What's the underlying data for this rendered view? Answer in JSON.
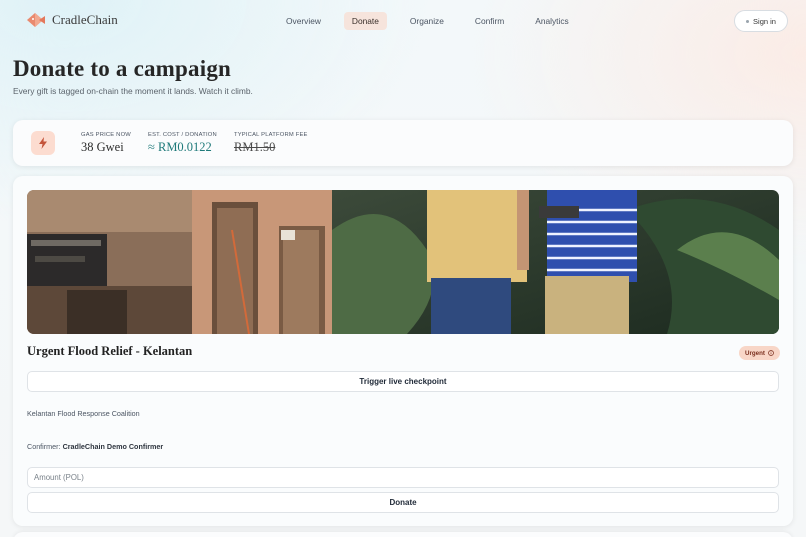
{
  "brand": {
    "name": "CradleChain"
  },
  "nav": {
    "tabs": [
      {
        "label": "Overview",
        "active": false
      },
      {
        "label": "Donate",
        "active": true
      },
      {
        "label": "Organize",
        "active": false
      },
      {
        "label": "Confirm",
        "active": false
      },
      {
        "label": "Analytics",
        "active": false
      }
    ],
    "signin_label": "Sign in"
  },
  "header": {
    "title": "Donate to a campaign",
    "subtitle": "Every gift is tagged on-chain the moment it lands. Watch it climb."
  },
  "gas": {
    "icon": "lightning-icon",
    "stats": [
      {
        "label": "GAS PRICE NOW",
        "value": "38 Gwei"
      },
      {
        "label": "EST. COST / DONATION",
        "value": "≈ RM0.0122"
      },
      {
        "label": "TYPICAL PLATFORM FEE",
        "value": "RM1.50"
      }
    ]
  },
  "campaign": {
    "title": "Urgent Flood Relief - Kelantan",
    "badge": "Urgent",
    "badge_icon": "info-icon",
    "checkpoint_button": "Trigger live checkpoint",
    "organization": "Kelantan Flood Response Coalition",
    "confirmer_label": "Confirmer:",
    "confirmer_name": "CradleChain Demo Confirmer",
    "amount_placeholder": "Amount (POL)",
    "donate_button": "Donate"
  },
  "colors": {
    "accent": "#f6e4dc",
    "badge_bg": "#f8d6c7",
    "teal": "#1f7a7a",
    "brand_logo": "#e98a6f"
  }
}
